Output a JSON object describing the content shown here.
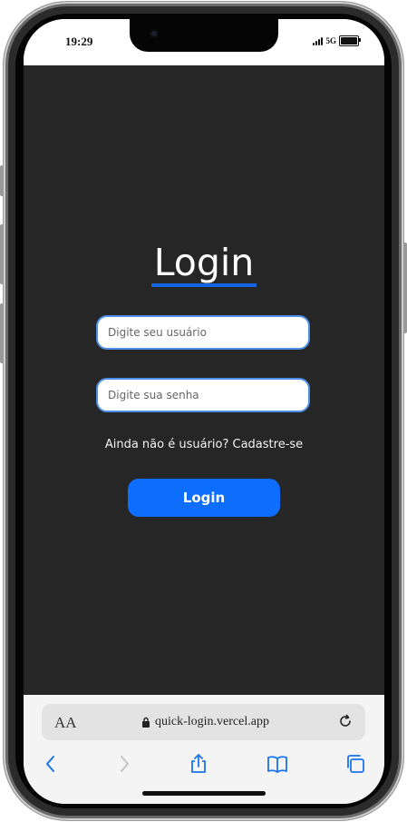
{
  "status_bar": {
    "time": "19:29",
    "network": "5G"
  },
  "page": {
    "title": "Login",
    "username_placeholder": "Digite seu usuário",
    "password_placeholder": "Digite sua senha",
    "signup_prompt": "Ainda não é usuário? Cadastre-se",
    "login_button": "Login"
  },
  "browser": {
    "aa_label": "AA",
    "url": "quick-login.vercel.app",
    "icons": [
      "back-icon",
      "forward-icon",
      "share-icon",
      "bookmarks-icon",
      "tabs-icon",
      "reload-icon",
      "lock-icon"
    ]
  },
  "colors": {
    "background": "#262626",
    "accent": "#0d6efd",
    "input_border": "#4d8ee8",
    "text": "#ffffff"
  }
}
